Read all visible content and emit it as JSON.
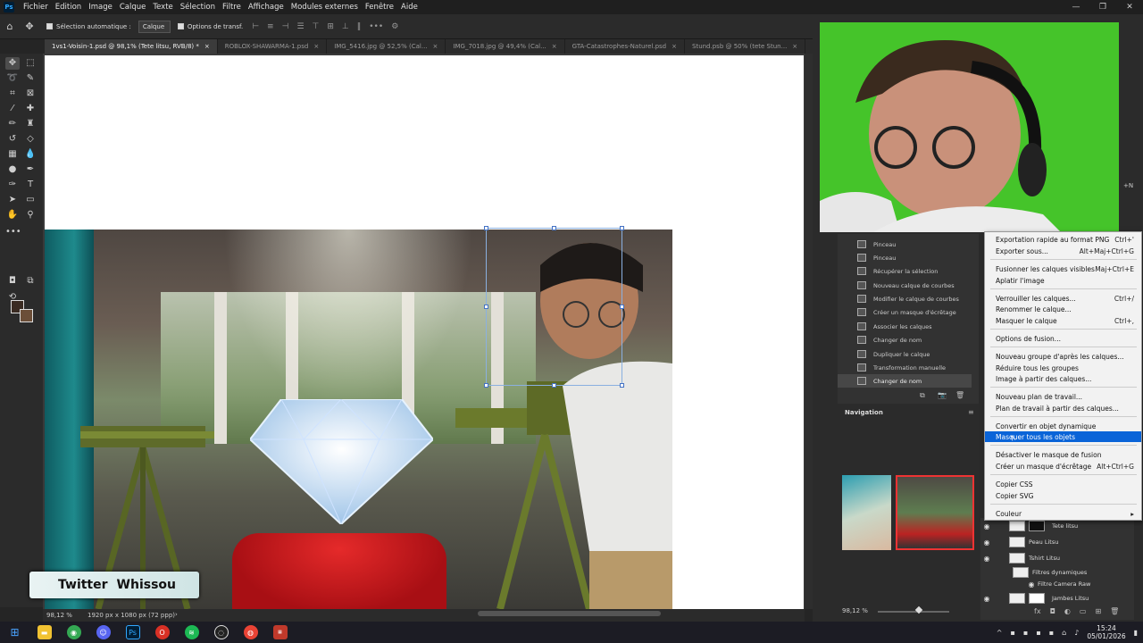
{
  "menubar": {
    "items": [
      "Fichier",
      "Edition",
      "Image",
      "Calque",
      "Texte",
      "Sélection",
      "Filtre",
      "Affichage",
      "Modules externes",
      "Fenêtre",
      "Aide"
    ],
    "logo": "Ps",
    "window_controls": [
      "—",
      "❐",
      "✕"
    ]
  },
  "optionsbar": {
    "auto_select_label": "Sélection automatique :",
    "auto_select_value": "Calque",
    "transform_label": "Options de transf."
  },
  "tabs": [
    {
      "label": "1vs1-Voisin-1.psd @ 98,1% (Tete litsu, RVB/8) *",
      "active": true
    },
    {
      "label": "ROBLOX-SHAWARMA-1.psd",
      "active": false
    },
    {
      "label": "IMG_5416.jpg @ 52,5% (Cal...",
      "active": false
    },
    {
      "label": "IMG_7018.jpg @ 49,4% (Cal...",
      "active": false
    },
    {
      "label": "GTA-Catastrophes-Naturel.psd",
      "active": false
    },
    {
      "label": "Stund.psb @ 50% (tete Stun...",
      "active": false
    }
  ],
  "statusbar": {
    "zoom": "98,12 %",
    "doc_info": "1920 px x 1080 px (72 ppp)"
  },
  "overlay": {
    "twitter_label": "Twitter",
    "twitter_handle": "Whissou"
  },
  "history": {
    "items": [
      "Pinceau",
      "Pinceau",
      "Récupérer la sélection",
      "Nouveau calque de courbes",
      "Modifier le calque de courbes",
      "Créer un masque d'écrêtage",
      "Associer les calques",
      "Changer de nom",
      "Dupliquer le calque",
      "Transformation manuelle",
      "Changer de nom"
    ]
  },
  "navigation": {
    "title": "Navigation",
    "zoom": "98,12 %"
  },
  "partial_shortcut": "+N",
  "layers": {
    "rows": [
      {
        "name": "Tete litsu",
        "visible": true
      },
      {
        "name": "Peau Litsu",
        "visible": true
      },
      {
        "name": "Tshirt Litsu",
        "visible": true
      },
      {
        "name": "Filtres dynamiques",
        "visible": false
      },
      {
        "name": "Filtre Camera Raw",
        "visible": true
      },
      {
        "name": "Jambes Litsu",
        "visible": true
      }
    ]
  },
  "context_menu": {
    "items": [
      {
        "label": "Exportation rapide au format PNG",
        "shortcut": "Ctrl+'"
      },
      {
        "label": "Exporter sous...",
        "shortcut": "Alt+Maj+Ctrl+G"
      },
      {
        "label": "Fusionner les calques visibles",
        "shortcut": "Maj+Ctrl+E"
      },
      {
        "label": "Aplatir l'image",
        "shortcut": ""
      },
      {
        "label": "Verrouiller les calques...",
        "shortcut": "Ctrl+/"
      },
      {
        "label": "Renommer le calque...",
        "shortcut": ""
      },
      {
        "label": "Masquer le calque",
        "shortcut": "Ctrl+,"
      },
      {
        "label": "Options de fusion...",
        "shortcut": ""
      },
      {
        "label": "Nouveau groupe d'après les calques...",
        "shortcut": ""
      },
      {
        "label": "Réduire tous les groupes",
        "shortcut": ""
      },
      {
        "label": "Image à partir des calques...",
        "shortcut": ""
      },
      {
        "label": "Nouveau plan de travail...",
        "shortcut": ""
      },
      {
        "label": "Plan de travail à partir des calques...",
        "shortcut": ""
      },
      {
        "label": "Convertir en objet dynamique",
        "shortcut": ""
      },
      {
        "label": "Masquer tous les objets",
        "shortcut": ""
      },
      {
        "label": "Désactiver le masque de fusion",
        "shortcut": ""
      },
      {
        "label": "Créer un masque d'écrêtage",
        "shortcut": "Alt+Ctrl+G"
      },
      {
        "label": "Copier CSS",
        "shortcut": ""
      },
      {
        "label": "Copier SVG",
        "shortcut": ""
      },
      {
        "label": "Couleur",
        "shortcut": "▸"
      }
    ]
  },
  "taskbar": {
    "time": "15:24",
    "date": "05/01/2026"
  },
  "colors": {
    "accent": "#0a64d8",
    "green_screen": "#45c42a"
  }
}
